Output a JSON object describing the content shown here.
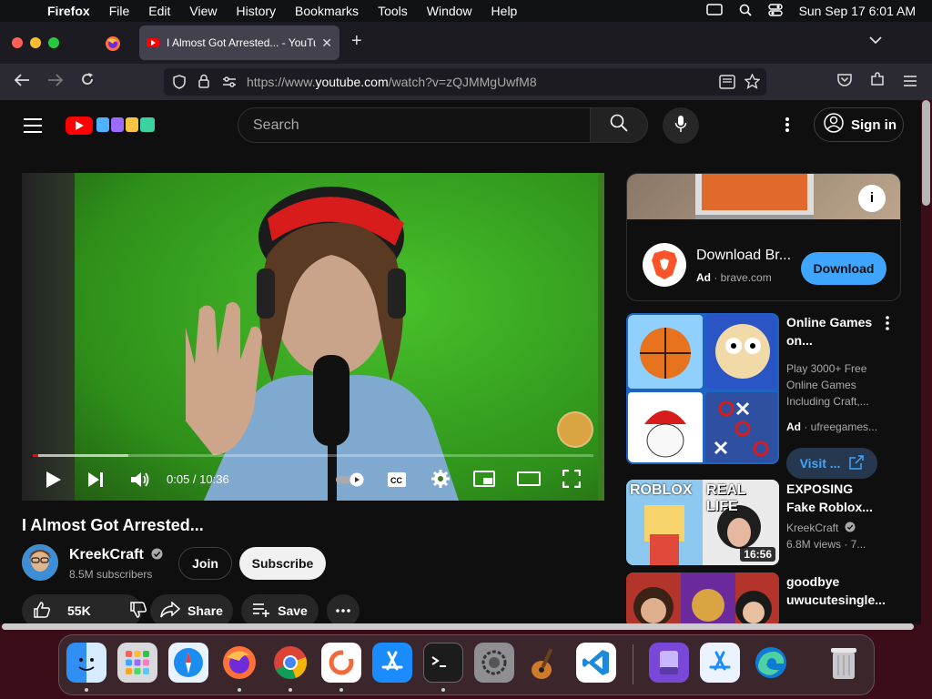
{
  "menubar": {
    "app": "Firefox",
    "items": [
      "File",
      "Edit",
      "View",
      "History",
      "Bookmarks",
      "Tools",
      "Window",
      "Help"
    ],
    "datetime": "Sun Sep 17  6:01 AM"
  },
  "browser": {
    "tab_title": "I Almost Got Arrested... - YouTube",
    "url_prefix": "https://www.",
    "url_domain": "youtube.com",
    "url_path": "/watch?v=zQJMMgUwfM8"
  },
  "youtube": {
    "search_placeholder": "Search",
    "sign_in": "Sign in",
    "player": {
      "time": "0:05 / 10:36",
      "progress_fraction": 0.008,
      "buffered_fraction": 0.17
    },
    "video_title": "I Almost Got Arrested...",
    "channel": {
      "name": "KreekCraft",
      "subscribers": "8.5M subscribers"
    },
    "join_label": "Join",
    "subscribe_label": "Subscribe",
    "likes": "55K",
    "share_label": "Share",
    "save_label": "Save"
  },
  "ad": {
    "title": "Download Br...",
    "ad_label": "Ad",
    "domain": "brave.com",
    "cta": "Download"
  },
  "recommendations": [
    {
      "title_line1": "Online Games",
      "title_line2": "on...",
      "desc_line1": "Play 3000+ Free",
      "desc_line2": "Online Games",
      "desc_line3": "Including Craft,...",
      "ad_label": "Ad",
      "domain": "ufreegames...",
      "cta": "Visit ..."
    },
    {
      "title_line1": "EXPOSING",
      "title_line2": "Fake Roblox...",
      "channel": "KreekCraft",
      "meta": "6.8M views · 7...",
      "duration": "16:56",
      "thumb_left": "ROBLOX",
      "thumb_right": "REAL LIFE"
    },
    {
      "title_line1": "goodbye",
      "title_line2": "uwucutesingle..."
    }
  ]
}
